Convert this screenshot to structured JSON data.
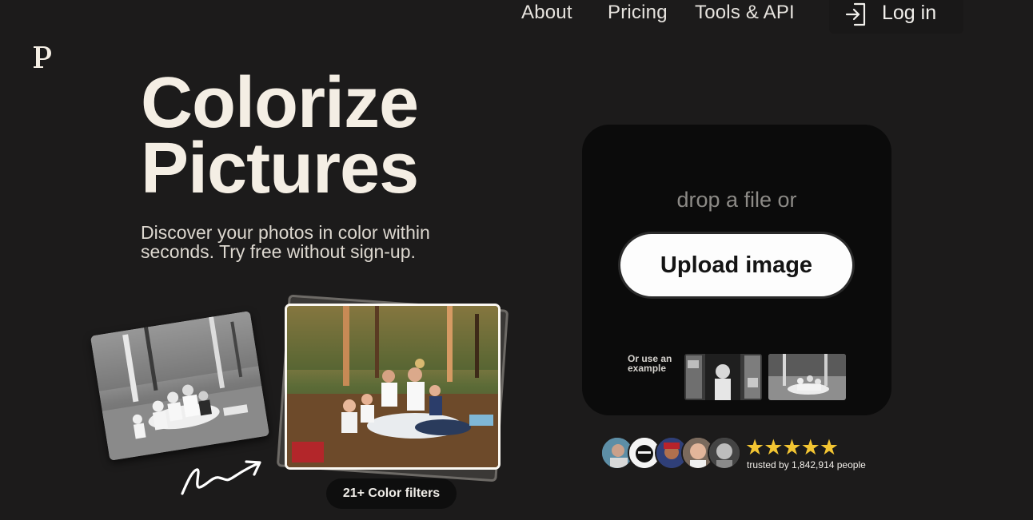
{
  "nav": {
    "about": "About",
    "pricing": "Pricing",
    "tools": "Tools & API",
    "login": "Log in"
  },
  "logo": {
    "letter": "P"
  },
  "hero": {
    "title_line1": "Colorize",
    "title_line2": "Pictures",
    "subtitle": "Discover your photos in color within seconds. Try free without sign-up."
  },
  "filters_badge": "21+ Color filters",
  "upload": {
    "drop_text": "drop a file or",
    "button_label": "Upload image",
    "example_label": "Or use an example"
  },
  "social_proof": {
    "stars": "★★★★★",
    "trusted_text": "trusted by 1,842,914 people"
  },
  "colors": {
    "background": "#1c1b1b",
    "card": "#0b0b0b",
    "star": "#f3c532"
  }
}
